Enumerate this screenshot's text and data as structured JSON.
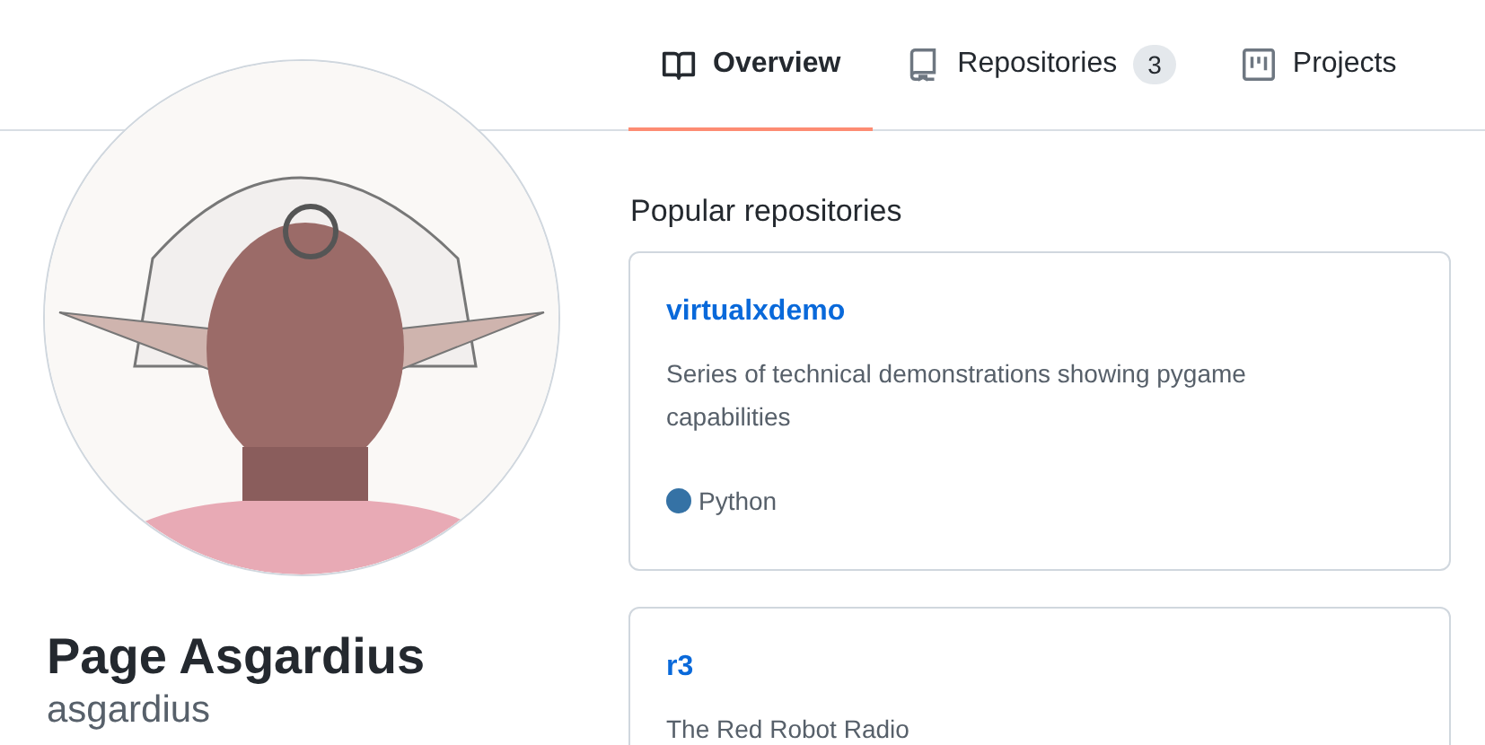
{
  "tabs": [
    {
      "label": "Overview",
      "kind": "book",
      "selected": true
    },
    {
      "label": "Repositories",
      "kind": "repo",
      "counter": "3",
      "selected": false
    },
    {
      "label": "Projects",
      "kind": "project",
      "selected": false
    }
  ],
  "profile": {
    "name": "Page Asgardius",
    "username": "asgardius"
  },
  "popular_repositories": {
    "heading": "Popular repositories",
    "items": [
      {
        "name": "virtualxdemo",
        "description": "Series of technical demonstrations showing pygame capabilities",
        "language": "Python",
        "color": "#3572a5"
      },
      {
        "name": "r3",
        "description": "The Red Robot Radio"
      }
    ]
  }
}
